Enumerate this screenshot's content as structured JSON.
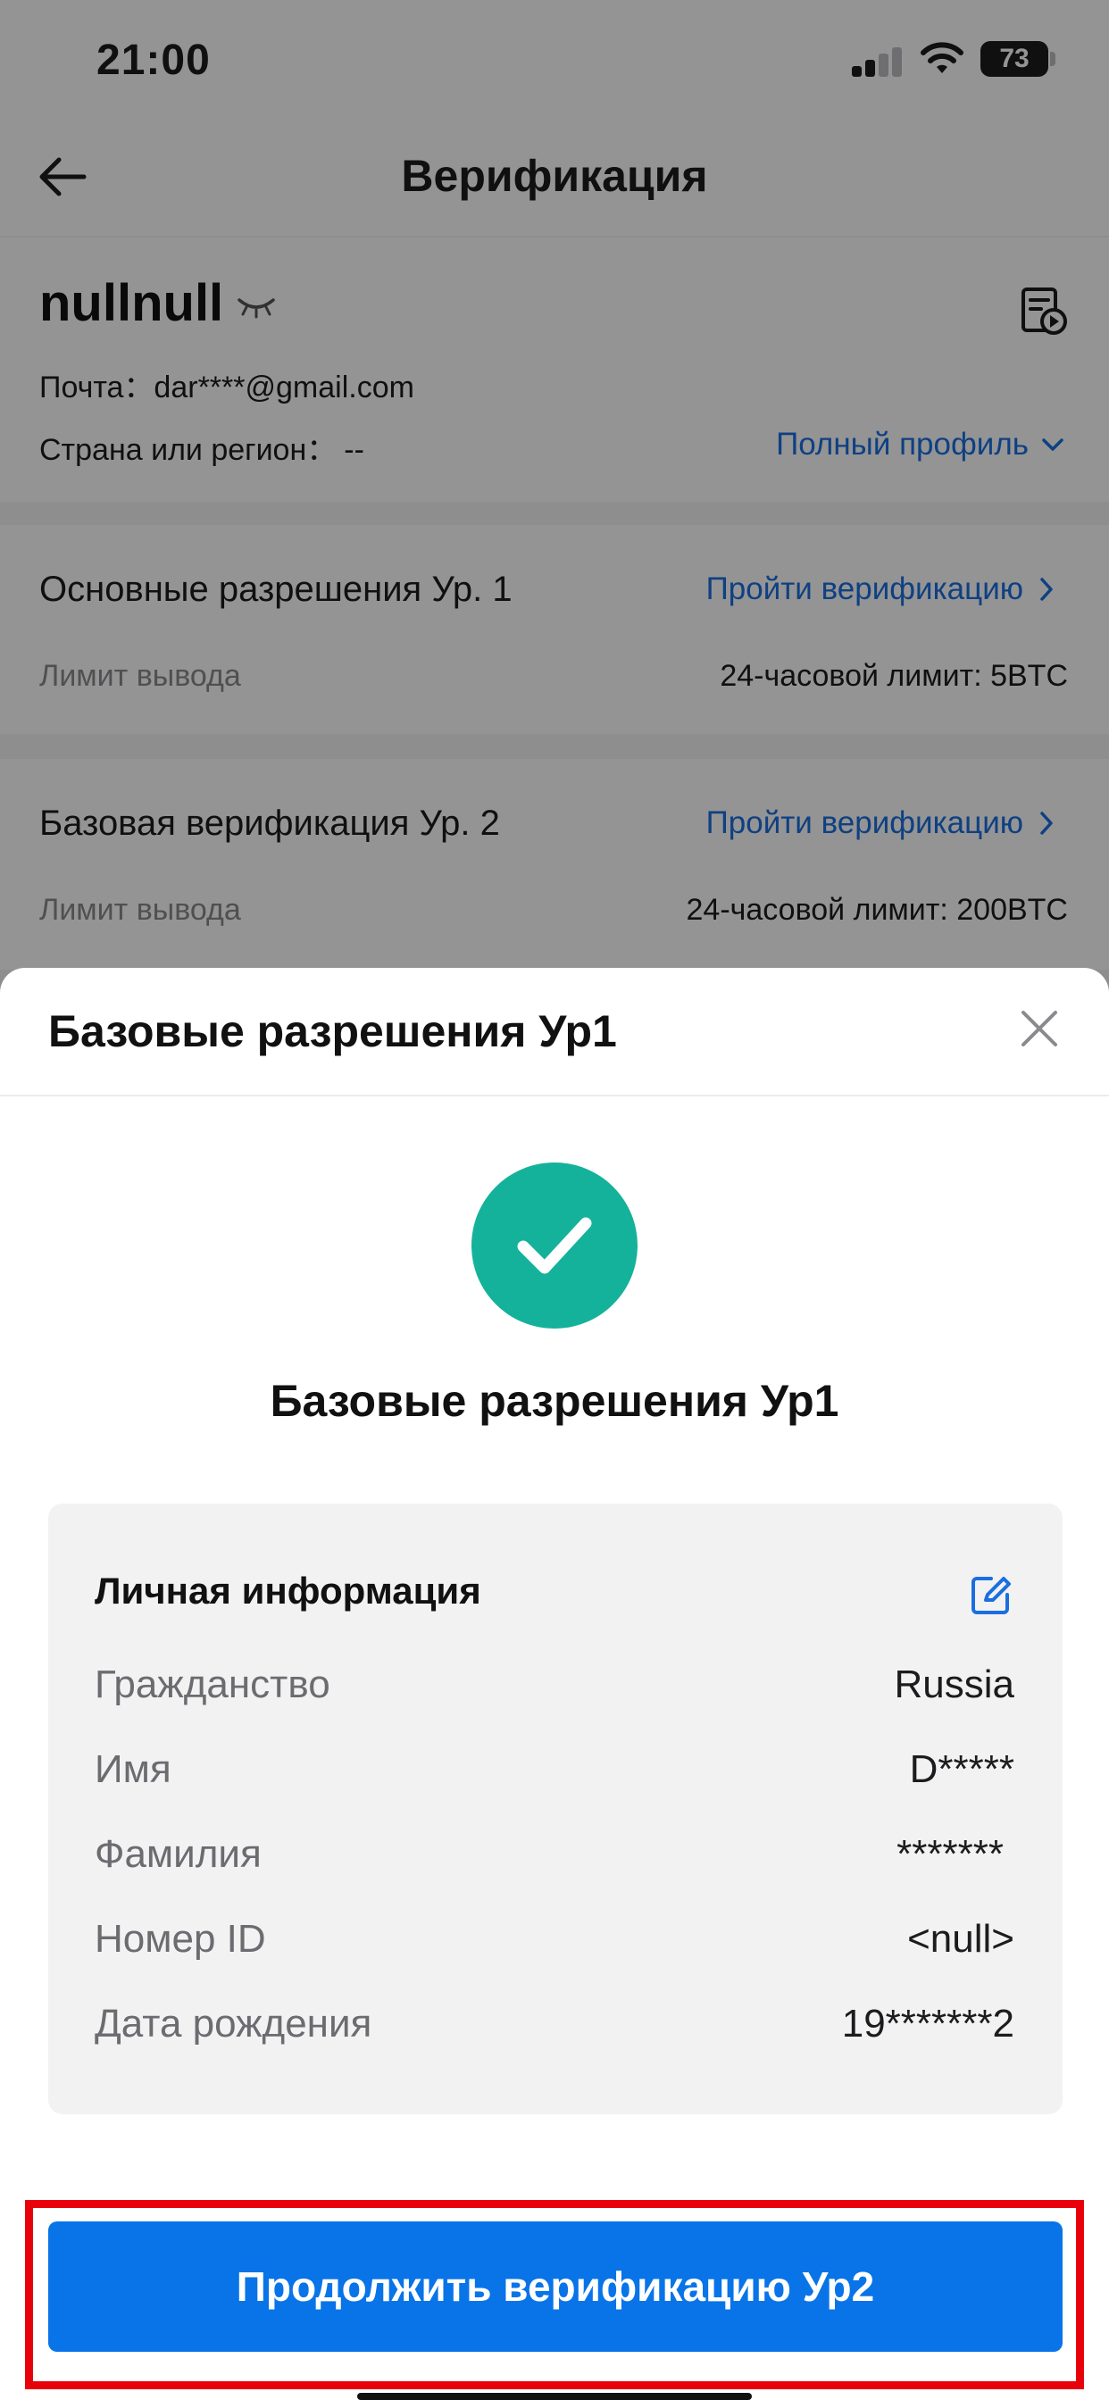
{
  "status_bar": {
    "time": "21:00",
    "battery": "73"
  },
  "nav": {
    "title": "Верификация"
  },
  "profile": {
    "username": "nullnull",
    "email_label": "Почта：",
    "email_value": "dar****@gmail.com",
    "country_label": "Страна или регион：",
    "country_value": "--",
    "full_profile_link": "Полный профиль"
  },
  "levels": [
    {
      "title": "Основные разрешения Ур. 1",
      "action": "Пройти верификацию",
      "limit_label": "Лимит вывода",
      "limit_value": "24-часовой лимит: 5BTC"
    },
    {
      "title": "Базовая верификация Ур. 2",
      "action": "Пройти верификацию",
      "limit_label": "Лимит вывода",
      "limit_value": "24-часовой лимит: 200BTC"
    }
  ],
  "sheet": {
    "title": "Базовые разрешения Ур1",
    "status_title": "Базовые разрешения Ур1",
    "info": {
      "section_title": "Личная информация",
      "rows": [
        {
          "label": "Гражданство",
          "value": "Russia"
        },
        {
          "label": "Имя",
          "value": "D*****"
        },
        {
          "label": "Фамилия",
          "value": "*******"
        },
        {
          "label": "Номер ID",
          "value": "<null>"
        },
        {
          "label": "Дата рождения",
          "value": "19*******2"
        }
      ]
    },
    "continue_button": "Продолжить верификацию Ур2"
  },
  "colors": {
    "accent": "#0874e8",
    "link": "#1a6fe0",
    "success": "#14b29a",
    "highlight": "#e8000b"
  }
}
